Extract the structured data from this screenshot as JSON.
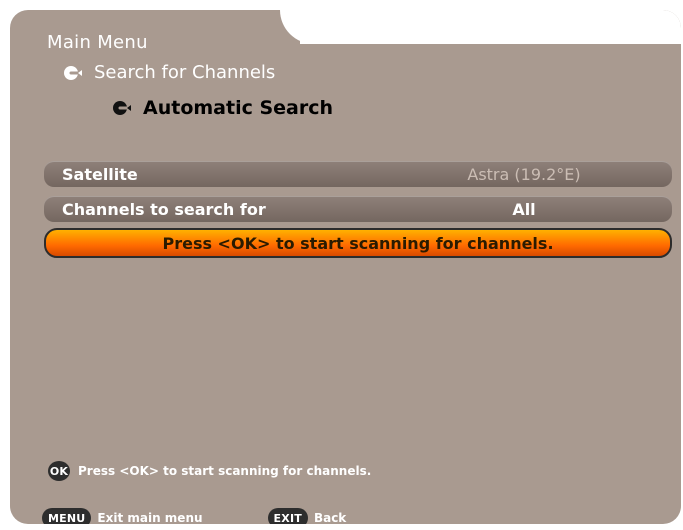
{
  "screen": {
    "background_color": "#ffffff",
    "panel_color": "#a99a90",
    "accent_color": "#ff7a00"
  },
  "header": {
    "title": "Main Menu"
  },
  "breadcrumbs": [
    {
      "label": "Search for Channels",
      "icon": "arrow-circle-icon"
    },
    {
      "label": "Automatic Search",
      "icon": "arrow-circle-icon"
    }
  ],
  "settings": [
    {
      "label": "Satellite",
      "value": "Astra (19.2°E)",
      "state": "disabled"
    },
    {
      "label": "Channels to search for",
      "value": "All",
      "state": "enabled"
    }
  ],
  "action": {
    "label": "Press <OK> to start scanning for channels."
  },
  "footer": {
    "hint": {
      "key": "OK",
      "text": "Press <OK> to start scanning for channels."
    },
    "legend": [
      {
        "key": "MENU",
        "label": "Exit main menu"
      },
      {
        "key": "EXIT",
        "label": "Back"
      }
    ]
  }
}
